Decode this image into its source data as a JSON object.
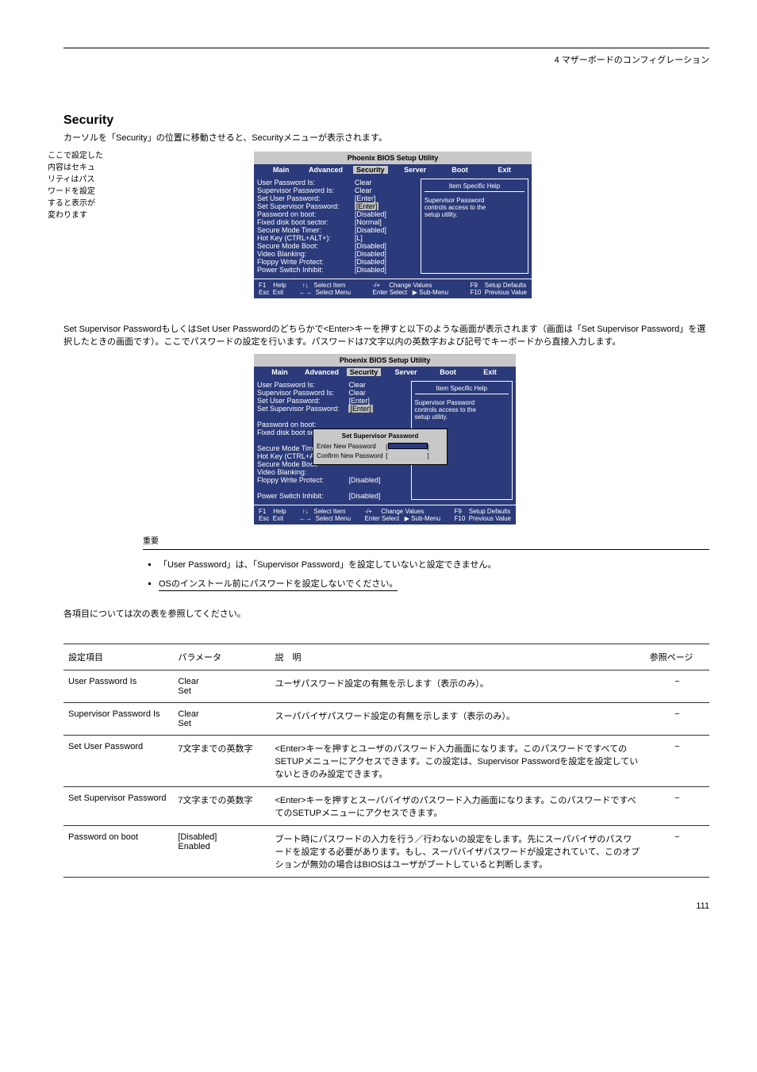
{
  "page_label_top": "4  マザーボードのコンフィグレーション",
  "section": {
    "title": "Security",
    "subtitle_prefix": "カーソルを「",
    "subtitle_mid": "Security",
    "subtitle_suffix": "」の位置に移動させると、Securityメニューが表示されます。"
  },
  "callouts": {
    "l1": "ここで設定した",
    "l2": "内容はセキュ",
    "l3": "リティはパス",
    "l4": "ワードを設定",
    "l5": "すると表示が",
    "l6": "変わります"
  },
  "bios": {
    "title": "Phoenix BIOS Setup Utility",
    "menus": [
      "Main",
      "Advanced",
      "Security",
      "Server",
      "Boot",
      "Exit"
    ],
    "active_menu_index": 2,
    "items": [
      {
        "k": "User Password Is:",
        "v": "Clear"
      },
      {
        "k": "Supervisor Password Is:",
        "v": "Clear"
      },
      {
        "k": "Set User Password:",
        "v": "[Enter]"
      },
      {
        "k": "Set Supervisor Password:",
        "v": "[Enter]",
        "selected": true
      },
      {
        "k": " ",
        "v": " "
      },
      {
        "k": "Password on boot:",
        "v": "[Disabled]"
      },
      {
        "k": "Fixed disk boot sector:",
        "v": "[Normal]"
      },
      {
        "k": " ",
        "v": " "
      },
      {
        "k": "Secure Mode Timer:",
        "v": "[Disabled]"
      },
      {
        "k": "Hot Key (CTRL+ALT+):",
        "v": "[L]"
      },
      {
        "k": "Secure Mode Boot:",
        "v": "[Disabled]"
      },
      {
        "k": "Video Blanking:",
        "v": "[Disabled]"
      },
      {
        "k": "Floppy Write Protect:",
        "v": "[Disabled]"
      },
      {
        "k": " ",
        "v": " "
      },
      {
        "k": "Power Switch Inhibit:",
        "v": "[Disabled]"
      }
    ],
    "help_title": "Item Specific Help",
    "help_body1": "Supervisor Password",
    "help_body2": "controls access to the",
    "help_body3": "setup utility.",
    "footer_col1": "F1    Help         ↑↓   Select Item\nEsc  Exit         ←→  Select Menu",
    "footer_col2": "-/+     Change Values\nEnter Select   ▶ Sub-Menu",
    "footer_col3": "F9    Setup Defaults\nF10  Previous Value"
  },
  "midtext": "Set Supervisor PasswordもしくはSet User Passwordのどちらかで<Enter>キーを押すと以下のような画面が表示されます（画面は「Set Supervisor Password」を選択したときの画面です）。ここでパスワードの設定を行います。パスワードは7文字以内の英数字および記号でキーボードから直接入力します。",
  "popup": {
    "title": "Set Supervisor Password",
    "enter": "Enter New Password",
    "confirm": "Confirm New Password"
  },
  "notes_label": "重要",
  "bullets": {
    "b1": "「User Password」は、「Supervisor Password」を設定していないと設定できません。",
    "b2": "OSのインストール前にパスワードを設定しないでください。"
  },
  "table_caption": "各項目については次の表を参照してください。",
  "table": {
    "headers": [
      "設定項目",
      "パラメータ",
      "説　明",
      "参照ページ"
    ],
    "rows": [
      {
        "c1": "User Password Is",
        "c2": "Clear\nSet",
        "c3": "ユーザパスワード設定の有無を示します（表示のみ）。",
        "c4": "−"
      },
      {
        "c1": "Supervisor Password Is",
        "c2": "Clear\nSet",
        "c3": "スーパバイザパスワード設定の有無を示します（表示のみ）。",
        "c4": "−"
      },
      {
        "c1": "Set User Password",
        "c2": "7文字までの英数字",
        "c3": "<Enter>キーを押すとユーザのパスワード入力画面になります。このパスワードですべてのSETUPメニューにアクセスできます。この設定は、Supervisor Passwordを設定を設定していないときのみ設定できます。",
        "c4": "−"
      },
      {
        "c1": "Set Supervisor Password",
        "c2": "7文字までの英数字",
        "c3": "<Enter>キーを押すとスーパバイザのパスワード入力画面になります。このパスワードですべてのSETUPメニューにアクセスできます。",
        "c4": "−"
      },
      {
        "c1": "Password on boot",
        "c2": "[Disabled]\nEnabled",
        "c3": "ブート時にパスワードの入力を行う／行わないの設定をします。先にスーパバイザのパスワードを設定する必要があります。もし、スーパバイザパスワードが設定されていて、このオプションが無効の場合はBIOSはユーザがブートしていると判断します。",
        "c4": "−"
      }
    ]
  },
  "page_number": "111"
}
